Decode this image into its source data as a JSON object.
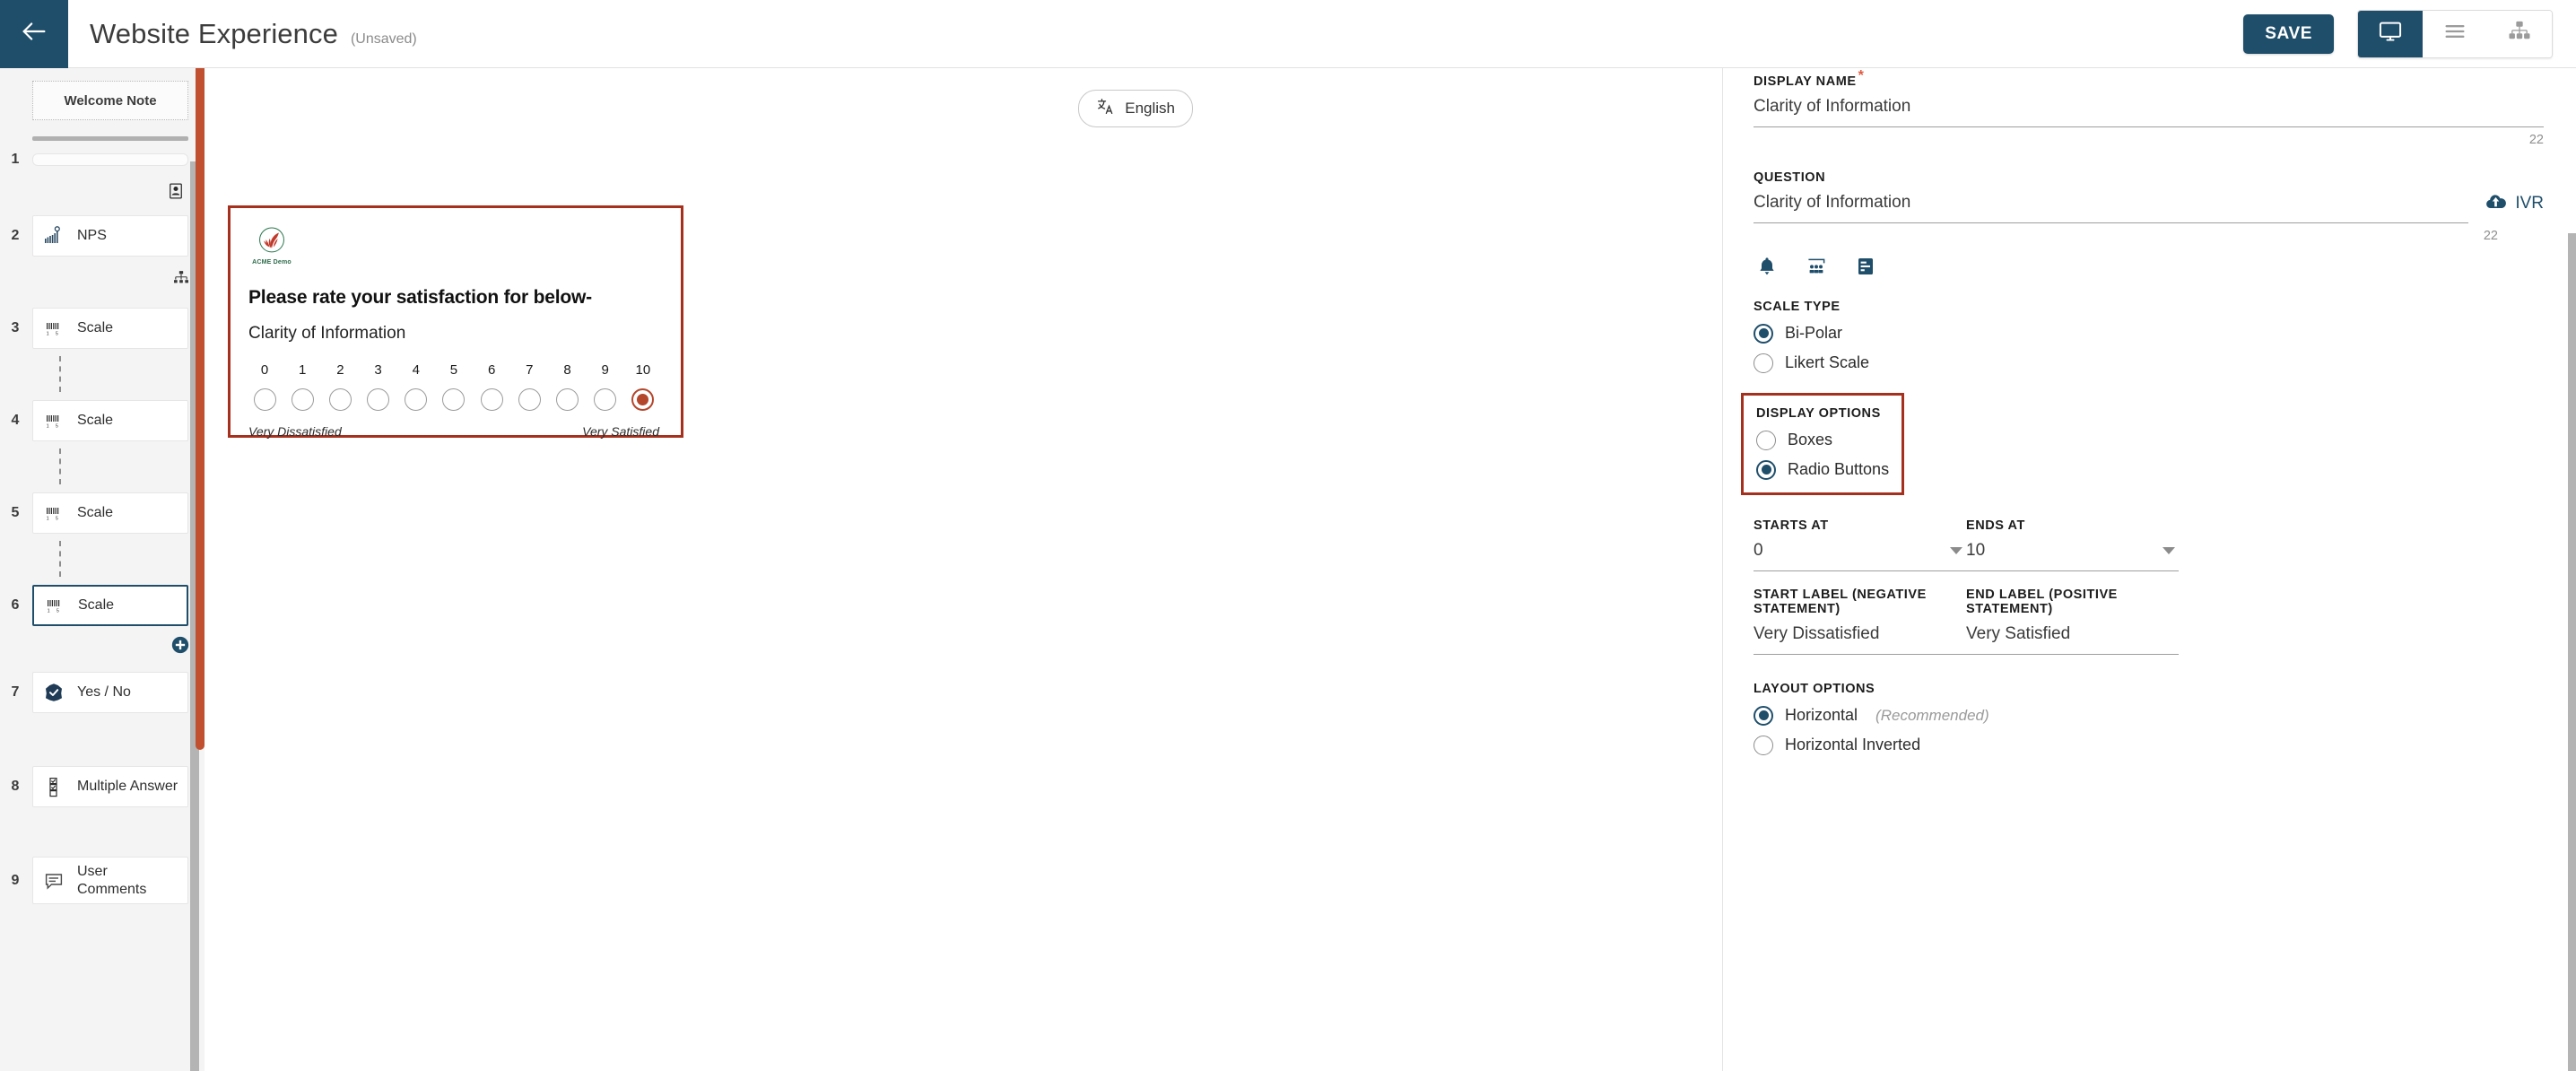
{
  "topbar": {
    "back_icon": "arrow-left-icon",
    "title": "Website Experience",
    "status": "(Unsaved)",
    "save_label": "SAVE",
    "view_modes": [
      {
        "name": "desktop-preview",
        "icon": "monitor-icon",
        "active": true
      },
      {
        "name": "list-view",
        "icon": "hamburger-icon",
        "active": false
      },
      {
        "name": "flow-view",
        "icon": "sitemap-icon",
        "active": false
      }
    ]
  },
  "sidebar": {
    "welcome_note": "Welcome Note",
    "items": [
      {
        "num": "1",
        "label": "",
        "icon": "placeholder-bar",
        "type": "stub",
        "selected": false
      },
      {
        "num": "2",
        "label": "NPS",
        "icon": "nps-icon",
        "type": "card",
        "selected": false
      },
      {
        "num": "3",
        "label": "Scale",
        "icon": "scale-icon",
        "type": "card",
        "selected": false
      },
      {
        "num": "4",
        "label": "Scale",
        "icon": "scale-icon",
        "type": "card",
        "selected": false
      },
      {
        "num": "5",
        "label": "Scale",
        "icon": "scale-icon",
        "type": "card",
        "selected": false
      },
      {
        "num": "6",
        "label": "Scale",
        "icon": "scale-icon",
        "type": "card",
        "selected": true
      },
      {
        "num": "7",
        "label": "Yes / No",
        "icon": "check-badge-icon",
        "type": "card",
        "selected": false
      },
      {
        "num": "8",
        "label": "Multiple Answer",
        "icon": "checklist-icon",
        "type": "card",
        "selected": false
      },
      {
        "num": "9",
        "label": "User Comments",
        "icon": "comment-icon",
        "type": "card",
        "selected": false
      }
    ],
    "inline_icons": {
      "contact_card": "contact-card-icon",
      "branching": "branching-icon",
      "add": "add-circle-icon"
    },
    "scroll_thumb_color": "#c0502f"
  },
  "canvas": {
    "language_pill": {
      "icon": "translate-icon",
      "label": "English"
    },
    "preview": {
      "brand_name": "ACME Demo",
      "prompt_main": "Please rate your satisfaction for below-",
      "prompt_sub": "Clarity of Information",
      "scale_values": [
        "0",
        "1",
        "2",
        "3",
        "4",
        "5",
        "6",
        "7",
        "8",
        "9",
        "10"
      ],
      "selected_value": "10",
      "anchor_left": "Very Dissatisfied",
      "anchor_right": "Very Satisfied",
      "border_color": "#a5301d",
      "selected_color": "#b4462c"
    }
  },
  "rightpanel": {
    "display_name": {
      "label": "DISPLAY NAME",
      "required": true,
      "value": "Clarity of Information",
      "char_count": "22"
    },
    "question": {
      "label": "QUESTION",
      "value": "Clarity of Information",
      "char_count": "22",
      "ivr_label": "IVR",
      "ivr_icon": "cloud-upload-icon",
      "toolbar_icons": [
        "bell-icon",
        "audience-icon",
        "form-layout-icon"
      ]
    },
    "scale_type": {
      "label": "SCALE TYPE",
      "options": [
        {
          "label": "Bi-Polar",
          "selected": true
        },
        {
          "label": "Likert Scale",
          "selected": false
        }
      ]
    },
    "display_options": {
      "label": "DISPLAY OPTIONS",
      "highlighted": true,
      "highlight_color": "#a5301d",
      "options": [
        {
          "label": "Boxes",
          "selected": false
        },
        {
          "label": "Radio Buttons",
          "selected": true
        }
      ]
    },
    "starts_at": {
      "label": "STARTS AT",
      "value": "0"
    },
    "ends_at": {
      "label": "ENDS AT",
      "value": "10"
    },
    "start_label": {
      "label": "START LABEL (NEGATIVE STATEMENT)",
      "value": "Very Dissatisfied"
    },
    "end_label": {
      "label": "END LABEL (POSITIVE STATEMENT)",
      "value": "Very Satisfied"
    },
    "layout_options": {
      "label": "LAYOUT OPTIONS",
      "options": [
        {
          "label": "Horizontal",
          "note": "(Recommended)",
          "selected": true
        },
        {
          "label": "Horizontal Inverted",
          "note": "",
          "selected": false
        }
      ]
    }
  },
  "theme": {
    "primary": "#1f4e6b",
    "accent": "#a5301d",
    "panel_bg": "#f4f4f4"
  }
}
